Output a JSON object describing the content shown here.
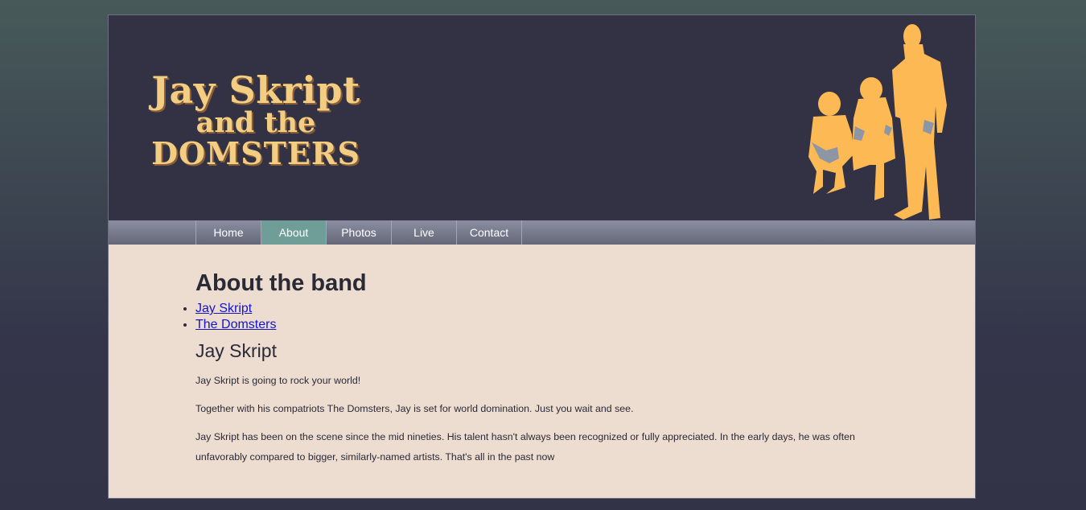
{
  "header": {
    "logo_lines": [
      "Jay Skript",
      "and the",
      "DOMSTERS"
    ]
  },
  "nav": {
    "items": [
      {
        "label": "Home"
      },
      {
        "label": "About"
      },
      {
        "label": "Photos"
      },
      {
        "label": "Live"
      },
      {
        "label": "Contact"
      }
    ],
    "current": "About"
  },
  "main": {
    "title": "About the band",
    "links": [
      "Jay Skript",
      "The Domsters"
    ],
    "section_title": "Jay Skript",
    "paragraphs": [
      "Jay Skript is going to rock your world!",
      "Together with his compatriots The Domsters, Jay is set for world domination. Just you wait and see.",
      "Jay Skript has been on the scene since the mid nineties. His talent hasn't always been recognized or fully appreciated. In the early days, he was often unfavorably compared to bigger, similarly-named artists. That's all in the past now"
    ]
  },
  "colors": {
    "header_bg": "#333245",
    "logo": "#f2cd82",
    "silhouette": "#fdb953",
    "content_bg": "#edddd0",
    "nav_active": "#6f9e99",
    "link": "#1515c7"
  },
  "icons": {
    "band_image": "band-silhouette-icon"
  }
}
